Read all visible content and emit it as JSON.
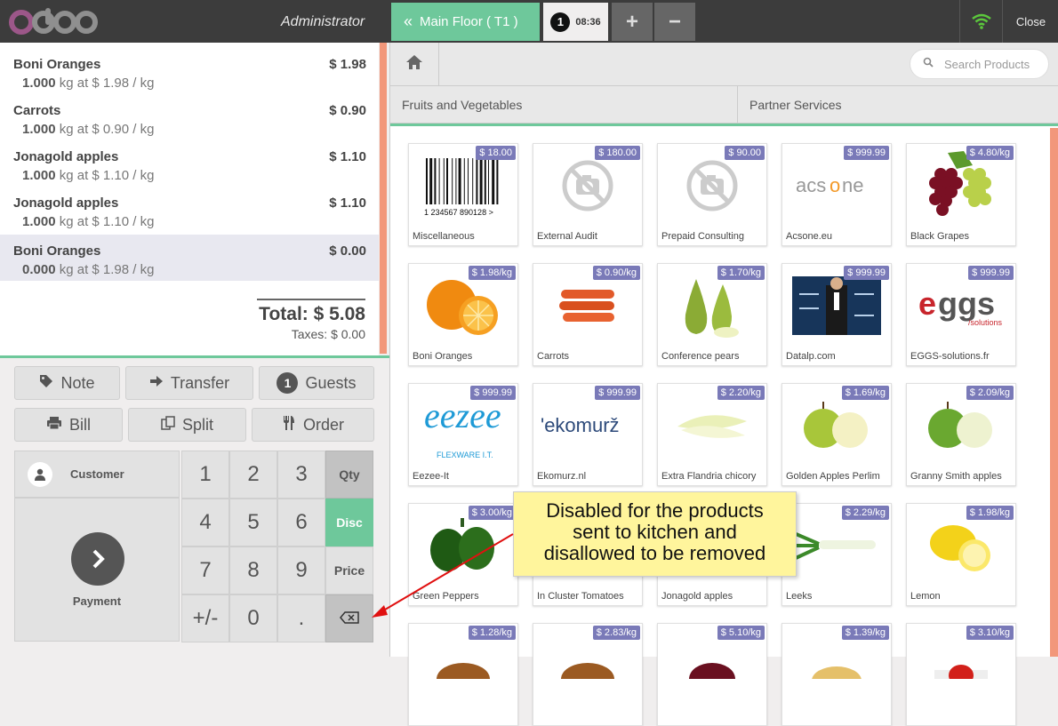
{
  "topbar": {
    "logo_text": "odoo",
    "user": "Administrator",
    "floor_button": "Main Floor ( T1 )",
    "order_tab": {
      "number": "1",
      "time": "08:36"
    },
    "add_order": "+",
    "remove_order": "−",
    "close": "Close"
  },
  "order": {
    "lines": [
      {
        "name": "Boni Oranges",
        "price": "$ 1.98",
        "qty": "1.000",
        "info": " kg at $ 1.98 / kg"
      },
      {
        "name": "Carrots",
        "price": "$ 0.90",
        "qty": "1.000",
        "info": " kg at $ 0.90 / kg"
      },
      {
        "name": "Jonagold apples",
        "price": "$ 1.10",
        "qty": "1.000",
        "info": " kg at $ 1.10 / kg"
      },
      {
        "name": "Jonagold apples",
        "price": "$ 1.10",
        "qty": "1.000",
        "info": " kg at $ 1.10 / kg"
      },
      {
        "name": "Boni Oranges",
        "price": "$ 0.00",
        "qty": "0.000",
        "info": " kg at $ 1.98 / kg"
      }
    ],
    "total": "Total: $ 5.08",
    "taxes": "Taxes: $ 0.00"
  },
  "actions": {
    "note": "Note",
    "transfer": "Transfer",
    "guests_count": "1",
    "guests": "Guests",
    "bill": "Bill",
    "split": "Split",
    "order": "Order"
  },
  "numpad": {
    "customer": "Customer",
    "payment": "Payment",
    "keys": [
      "1",
      "2",
      "3",
      "4",
      "5",
      "6",
      "7",
      "8",
      "9",
      "+/-",
      "0",
      "."
    ],
    "modes": {
      "qty": "Qty",
      "disc": "Disc",
      "price": "Price"
    }
  },
  "products_panel": {
    "search_placeholder": "Search Products",
    "categories": [
      "Fruits and Vegetables",
      "Partner Services"
    ],
    "products": [
      {
        "name": "Miscellaneous",
        "price": "$ 18.00",
        "icon": "barcode-image"
      },
      {
        "name": "External Audit",
        "price": "$ 180.00",
        "icon": "no-photo-icon"
      },
      {
        "name": "Prepaid Consulting",
        "price": "$ 90.00",
        "icon": "no-photo-icon"
      },
      {
        "name": "Acsone.eu",
        "price": "$ 999.99",
        "icon": "acsone-logo"
      },
      {
        "name": "Black Grapes",
        "price": "$ 4.80/kg",
        "icon": "grapes-image"
      },
      {
        "name": "Boni Oranges",
        "price": "$ 1.98/kg",
        "icon": "orange-image"
      },
      {
        "name": "Carrots",
        "price": "$ 0.90/kg",
        "icon": "carrots-image"
      },
      {
        "name": "Conference pears",
        "price": "$ 1.70/kg",
        "icon": "pears-image"
      },
      {
        "name": "Datalp.com",
        "price": "$ 999.99",
        "icon": "datalp-image"
      },
      {
        "name": "EGGS-solutions.fr",
        "price": "$ 999.99",
        "icon": "eggs-logo"
      },
      {
        "name": "Eezee-It",
        "price": "$ 999.99",
        "icon": "eezee-logo"
      },
      {
        "name": "Ekomurz.nl",
        "price": "$ 999.99",
        "icon": "ekomurz-logo"
      },
      {
        "name": "Extra Flandria chicory",
        "price": "$ 2.20/kg",
        "icon": "chicory-image"
      },
      {
        "name": "Golden Apples Perlim",
        "price": "$ 1.69/kg",
        "icon": "golden-apple-image"
      },
      {
        "name": "Granny Smith apples",
        "price": "$ 2.09/kg",
        "icon": "green-apple-image"
      },
      {
        "name": "Green Peppers",
        "price": "$ 3.00/kg",
        "icon": "green-pepper-image"
      },
      {
        "name": "In Cluster Tomatoes",
        "price": "",
        "icon": "tomato-image"
      },
      {
        "name": "Jonagold apples",
        "price": "",
        "icon": "apple-image"
      },
      {
        "name": "Leeks",
        "price": "$ 2.29/kg",
        "icon": "leek-image"
      },
      {
        "name": "Lemon",
        "price": "$ 1.98/kg",
        "icon": "lemon-image"
      },
      {
        "name": "",
        "price": "$ 1.28/kg",
        "icon": "onion-image"
      },
      {
        "name": "",
        "price": "$ 2.83/kg",
        "icon": "onion-image"
      },
      {
        "name": "",
        "price": "$ 5.10/kg",
        "icon": "plum-image"
      },
      {
        "name": "",
        "price": "$ 1.39/kg",
        "icon": "potato-image"
      },
      {
        "name": "",
        "price": "$ 3.10/kg",
        "icon": "red-pepper-image"
      }
    ]
  },
  "annotation": {
    "text_line1": "Disabled for the products",
    "text_line2": "sent to kitchen and",
    "text_line3": "disallowed to be removed",
    "arrow_color": "#e01010"
  },
  "colors": {
    "accent_green": "#6ec89b",
    "accent_orange": "#f2977a",
    "price_badge": "#7a7ab8",
    "topbar": "#3c3c3c"
  }
}
